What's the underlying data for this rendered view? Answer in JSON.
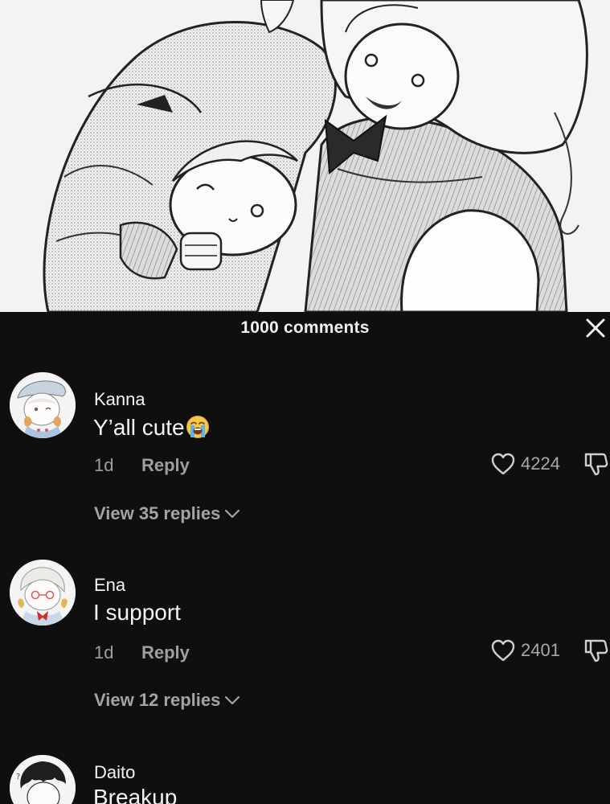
{
  "header": {
    "comment_count_label": "1000 comments"
  },
  "comments": [
    {
      "username": "Kanna",
      "text": "Y’all cute",
      "emoji": "loudly-crying-face",
      "time": "1d",
      "reply_label": "Reply",
      "likes": "4224",
      "view_replies_label": "View 35 replies"
    },
    {
      "username": "Ena",
      "text": "I support",
      "time": "1d",
      "reply_label": "Reply",
      "likes": "2401",
      "view_replies_label": "View 12 replies"
    },
    {
      "username": "Daito",
      "text": "Breakup"
    }
  ],
  "colors": {
    "sheet_background": "#0f0f10",
    "primary_text": "#f2f2f2",
    "secondary_text": "#9e9e9e",
    "manga_background": "#f3f3f1"
  },
  "icons": [
    "close-icon",
    "heart-icon",
    "dislike-icon",
    "chevron-down-icon",
    "loudly-crying-face-emoji"
  ]
}
